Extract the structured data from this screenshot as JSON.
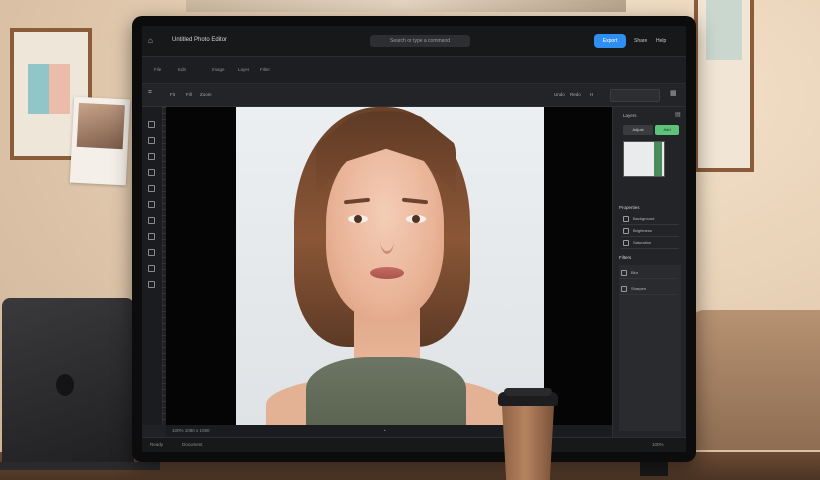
{
  "scene": {
    "description_objects": [
      "monitor",
      "laptop",
      "coffee-cup",
      "picture-frames",
      "sofa"
    ]
  },
  "app": {
    "home_icon": "home-icon",
    "title": "Untitled Photo Editor",
    "search_placeholder": "Search or type a command",
    "primary_button": "Export",
    "top_right_items": [
      "Share",
      "Help"
    ]
  },
  "tabs": [
    "File",
    "Edit",
    "Image",
    "Layer",
    "Filter"
  ],
  "toolbar": {
    "items": [
      "Fit",
      "Fill",
      "Zoom"
    ],
    "right_items": [
      "Undo",
      "Redo",
      "H"
    ],
    "zoom_value": ""
  },
  "tools": [
    "move-tool-icon",
    "select-tool-icon",
    "lasso-icon",
    "crop-icon",
    "brush-icon",
    "eraser-icon",
    "clone-icon",
    "text-icon",
    "shape-icon",
    "hand-icon",
    "zoom-icon"
  ],
  "canvas": {
    "status_left": "100%  1080 x 1080",
    "status_center": "•"
  },
  "panel": {
    "title": "Layers",
    "btn_left": "Adjust",
    "btn_right": "Add",
    "section": "Properties",
    "rows": [
      "Background",
      "Brightness",
      "Saturation"
    ],
    "subheader": "Filters",
    "list_rows": [
      "Blur",
      "Sharpen"
    ]
  },
  "bottombar": {
    "left": "Ready",
    "center": "Document",
    "right": "100%"
  },
  "colors": {
    "accent": "#2f8ef2",
    "panel_green": "#5fc27a",
    "app_bg": "#202124"
  }
}
